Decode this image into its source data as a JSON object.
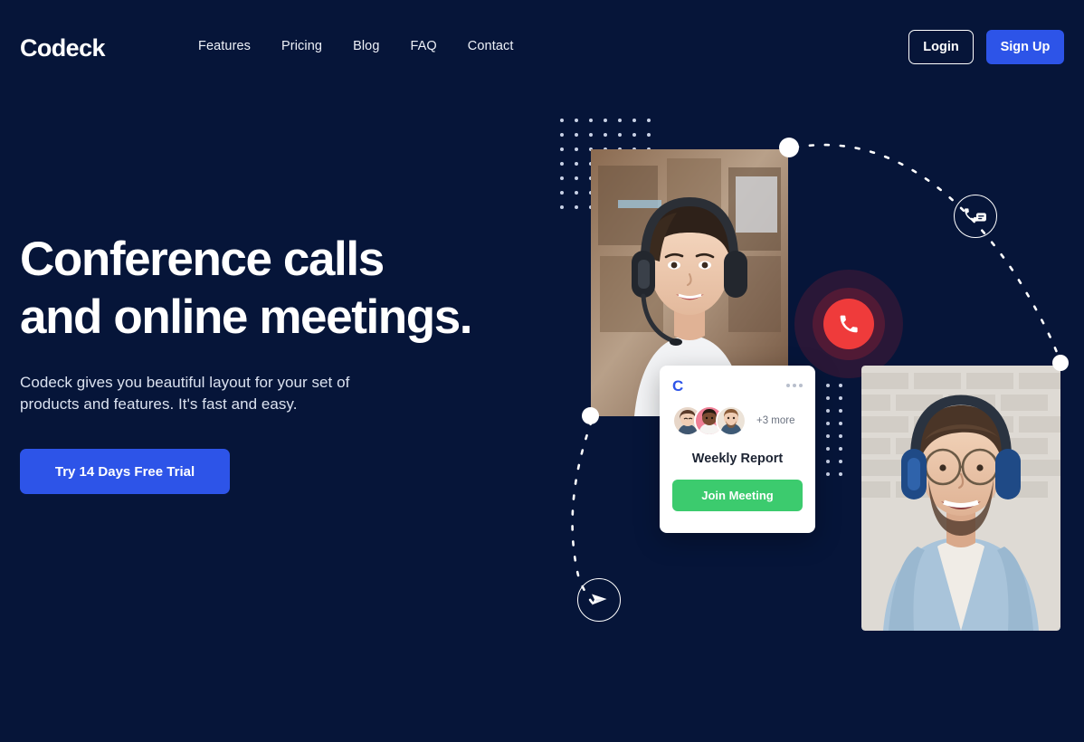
{
  "brand": {
    "name": "Codeck"
  },
  "nav": {
    "links": [
      {
        "label": "Features"
      },
      {
        "label": "Pricing"
      },
      {
        "label": "Blog"
      },
      {
        "label": "FAQ"
      },
      {
        "label": "Contact"
      }
    ],
    "login_label": "Login",
    "signup_label": "Sign Up"
  },
  "hero": {
    "title_line1": "Conference calls",
    "title_line2": "and online meetings.",
    "subtitle": "Codeck gives you beautiful layout for your set of products and features. It's fast and easy.",
    "cta_label": "Try 14 Days Free Trial"
  },
  "meeting_card": {
    "logo_text": "C",
    "more_label": "+3 more",
    "title": "Weekly Report",
    "join_label": "Join Meeting"
  },
  "colors": {
    "background": "#061539",
    "accent_blue": "#2d54e8",
    "accent_green": "#3ccb6e",
    "accent_red": "#ef3b3b",
    "text_light": "#ffffff",
    "text_muted": "#dbe2f0"
  },
  "icons": {
    "call": "phone-icon",
    "chat": "phone-chat-icon",
    "send": "paper-plane-icon",
    "menu": "more-dots-icon"
  }
}
